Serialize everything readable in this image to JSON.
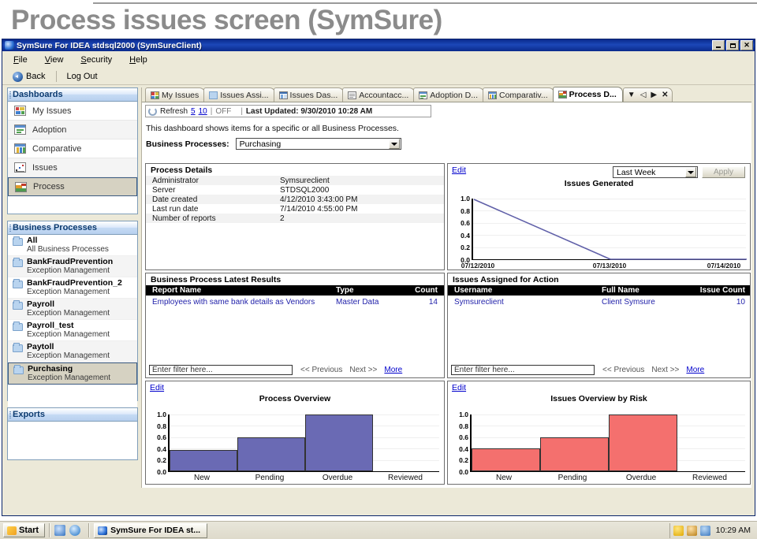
{
  "slide": {
    "title": "Process issues screen (SymSure)"
  },
  "window": {
    "title": "SymSure For IDEA  stdsql2000 (SymSureClient)",
    "minimize_label": "_",
    "maximize_label": "□",
    "close_label": "✕"
  },
  "menu": {
    "items": [
      "File",
      "View",
      "Security",
      "Help"
    ]
  },
  "toolbar": {
    "back_label": "Back",
    "logout_label": "Log Out"
  },
  "sidebar": {
    "dashboards_header": "Dashboards",
    "dashboards": [
      {
        "label": "My Issues",
        "icon": "grid-icon",
        "selected": false
      },
      {
        "label": "Adoption",
        "icon": "window-chart-icon",
        "selected": false
      },
      {
        "label": "Comparative",
        "icon": "columns-icon",
        "selected": false
      },
      {
        "label": "Issues",
        "icon": "scatter-icon",
        "selected": false
      },
      {
        "label": "Process",
        "icon": "area-chart-icon",
        "selected": true
      }
    ],
    "business_processes_header": "Business Processes",
    "business_processes": [
      {
        "name": "All",
        "sub": "All Business Processes",
        "selected": false
      },
      {
        "name": "BankFraudPrevention",
        "sub": "Exception Management",
        "selected": false
      },
      {
        "name": "BankFraudPrevention_2",
        "sub": "Exception Management",
        "selected": false
      },
      {
        "name": "Payroll",
        "sub": "Exception Management",
        "selected": false
      },
      {
        "name": "Payroll_test",
        "sub": "Exception Management",
        "selected": false
      },
      {
        "name": "Paytoll",
        "sub": "Exception Management",
        "selected": false
      },
      {
        "name": "Purchasing",
        "sub": "Exception Management",
        "selected": true
      }
    ],
    "exports_header": "Exports"
  },
  "tabs": [
    {
      "label": "My Issues",
      "icon": "grid-icon",
      "active": false
    },
    {
      "label": "Issues Assi...",
      "icon": "folder-icon",
      "active": false
    },
    {
      "label": "Issues Das...",
      "icon": "table-icon",
      "active": false
    },
    {
      "label": "Accountacc...",
      "icon": "document-icon",
      "active": false
    },
    {
      "label": "Adoption D...",
      "icon": "window-chart-icon",
      "active": false
    },
    {
      "label": "Comparativ...",
      "icon": "columns-icon",
      "active": false
    },
    {
      "label": "Process D...",
      "icon": "area-chart-icon",
      "active": true
    }
  ],
  "tab_controls": {
    "list_icon": "chevron-list-icon",
    "prev_icon": "prev-arrow-icon",
    "next_icon": "next-arrow-icon",
    "close_icon": "close-icon"
  },
  "refresh_bar": {
    "refresh_label": "Refresh",
    "option_5": "5",
    "option_10": "10",
    "state": "OFF",
    "last_updated": "Last Updated: 9/30/2010 10:28 AM"
  },
  "description": "This dashboard shows items for a specific or all Business Processes.",
  "business_process_select": {
    "label": "Business Processes:",
    "value": "Purchasing"
  },
  "process_details": {
    "title": "Process Details",
    "rows": [
      {
        "key": "Administrator",
        "value": "Symsureclient"
      },
      {
        "key": "Server",
        "value": "STDSQL2000"
      },
      {
        "key": "Date created",
        "value": "4/12/2010 3:43:00 PM"
      },
      {
        "key": "Last run date",
        "value": "7/14/2010 4:55:00 PM"
      },
      {
        "key": "Number of reports",
        "value": "2"
      }
    ]
  },
  "latest_results": {
    "title": "Business Process Latest Results",
    "columns": [
      "Report Name",
      "Type",
      "Count"
    ],
    "rows": [
      {
        "name": "Employees with same bank details as Vendors",
        "type": "Master Data",
        "count": "14"
      }
    ],
    "filter_placeholder": "Enter filter here...",
    "prev_label": "<< Previous",
    "next_label": "Next >>",
    "more_label": "More"
  },
  "issues_assigned": {
    "title": "Issues Assigned for Action",
    "columns": [
      "Username",
      "Full Name",
      "Issue Count"
    ],
    "rows": [
      {
        "username": "Symsureclient",
        "fullname": "Client Symsure",
        "count": "10"
      }
    ],
    "filter_placeholder": "Enter filter here...",
    "prev_label": "<< Previous",
    "next_label": "Next >>",
    "more_label": "More"
  },
  "edit_link_label": "Edit",
  "period_filter": {
    "value": "Last Week",
    "apply_label": "Apply"
  },
  "colors": {
    "titlebar": "#0a2a8c",
    "panel_header": "#b7d0ef",
    "link": "#0000cc",
    "line_series": "#5f5fa8",
    "bar_blue": "#6a6ab4",
    "bar_red": "#f4706e"
  },
  "chart_data": [
    {
      "id": "issues-generated",
      "type": "line",
      "title": "Issues Generated",
      "xlabel": "",
      "ylabel": "",
      "x": [
        "07/12/2010",
        "07/13/2010",
        "07/14/2010"
      ],
      "series": [
        {
          "name": "Issues Generated",
          "values": [
            1.0,
            0.0,
            0.0
          ],
          "color": "#5f5fa8"
        }
      ],
      "yticks": [
        "1.0",
        "0.8",
        "0.6",
        "0.4",
        "0.2",
        "0.0"
      ],
      "ylim": [
        0,
        1
      ],
      "grid": true,
      "legend": "none"
    },
    {
      "id": "process-overview",
      "type": "bar",
      "title": "Process Overview",
      "xlabel": "",
      "ylabel": "",
      "categories": [
        "New",
        "Pending",
        "Overdue",
        "Reviewed"
      ],
      "values": [
        0.38,
        0.6,
        1.0,
        0.0
      ],
      "yticks": [
        "1.0",
        "0.8",
        "0.6",
        "0.4",
        "0.2",
        "0.0"
      ],
      "ylim": [
        0,
        1
      ],
      "color": "#6a6ab4",
      "grid": true,
      "legend": "none"
    },
    {
      "id": "issues-overview-by-risk",
      "type": "bar",
      "title": "Issues Overview by Risk",
      "xlabel": "",
      "ylabel": "",
      "categories": [
        "New",
        "Pending",
        "Overdue",
        "Reviewed"
      ],
      "values": [
        0.4,
        0.6,
        1.0,
        0.0
      ],
      "yticks": [
        "1.0",
        "0.8",
        "0.6",
        "0.4",
        "0.2",
        "0.0"
      ],
      "ylim": [
        0,
        1
      ],
      "color": "#f4706e",
      "grid": true,
      "legend": "none"
    }
  ],
  "taskbar": {
    "start_label": "Start",
    "task_label": "SymSure For IDEA  st...",
    "clock": "10:29 AM"
  }
}
